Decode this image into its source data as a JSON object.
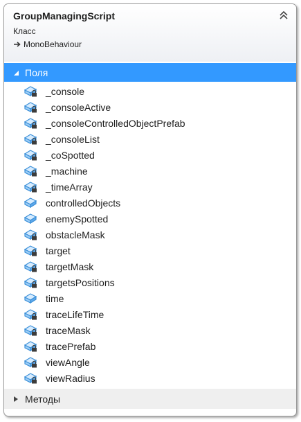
{
  "class": {
    "name": "GroupManagingScript",
    "kind": "Класс",
    "base": "MonoBehaviour"
  },
  "sections": {
    "fields": {
      "label": "Поля",
      "expanded": true
    },
    "methods": {
      "label": "Методы",
      "expanded": false
    }
  },
  "fields": [
    {
      "name": "_console",
      "icon": "field-private-icon"
    },
    {
      "name": "_consoleActive",
      "icon": "field-private-icon"
    },
    {
      "name": "_consoleControlledObjectPrefab",
      "icon": "field-private-icon"
    },
    {
      "name": "_consoleList",
      "icon": "field-private-icon"
    },
    {
      "name": "_coSpotted",
      "icon": "field-private-icon"
    },
    {
      "name": "_machine",
      "icon": "field-private-icon"
    },
    {
      "name": "_timeArray",
      "icon": "field-private-icon"
    },
    {
      "name": "controlledObjects",
      "icon": "field-public-icon"
    },
    {
      "name": "enemySpotted",
      "icon": "field-public-icon"
    },
    {
      "name": "obstacleMask",
      "icon": "field-private-icon"
    },
    {
      "name": "target",
      "icon": "field-private-icon"
    },
    {
      "name": "targetMask",
      "icon": "field-private-icon"
    },
    {
      "name": "targetsPositions",
      "icon": "field-private-icon"
    },
    {
      "name": "time",
      "icon": "field-public-icon"
    },
    {
      "name": "traceLifeTime",
      "icon": "field-private-icon"
    },
    {
      "name": "traceMask",
      "icon": "field-private-icon"
    },
    {
      "name": "tracePrefab",
      "icon": "field-private-icon"
    },
    {
      "name": "viewAngle",
      "icon": "field-private-icon"
    },
    {
      "name": "viewRadius",
      "icon": "field-private-icon"
    }
  ],
  "colors": {
    "selection": "#3399ff",
    "field_icon": "#3a8fd8",
    "text": "#1e1e1e"
  }
}
